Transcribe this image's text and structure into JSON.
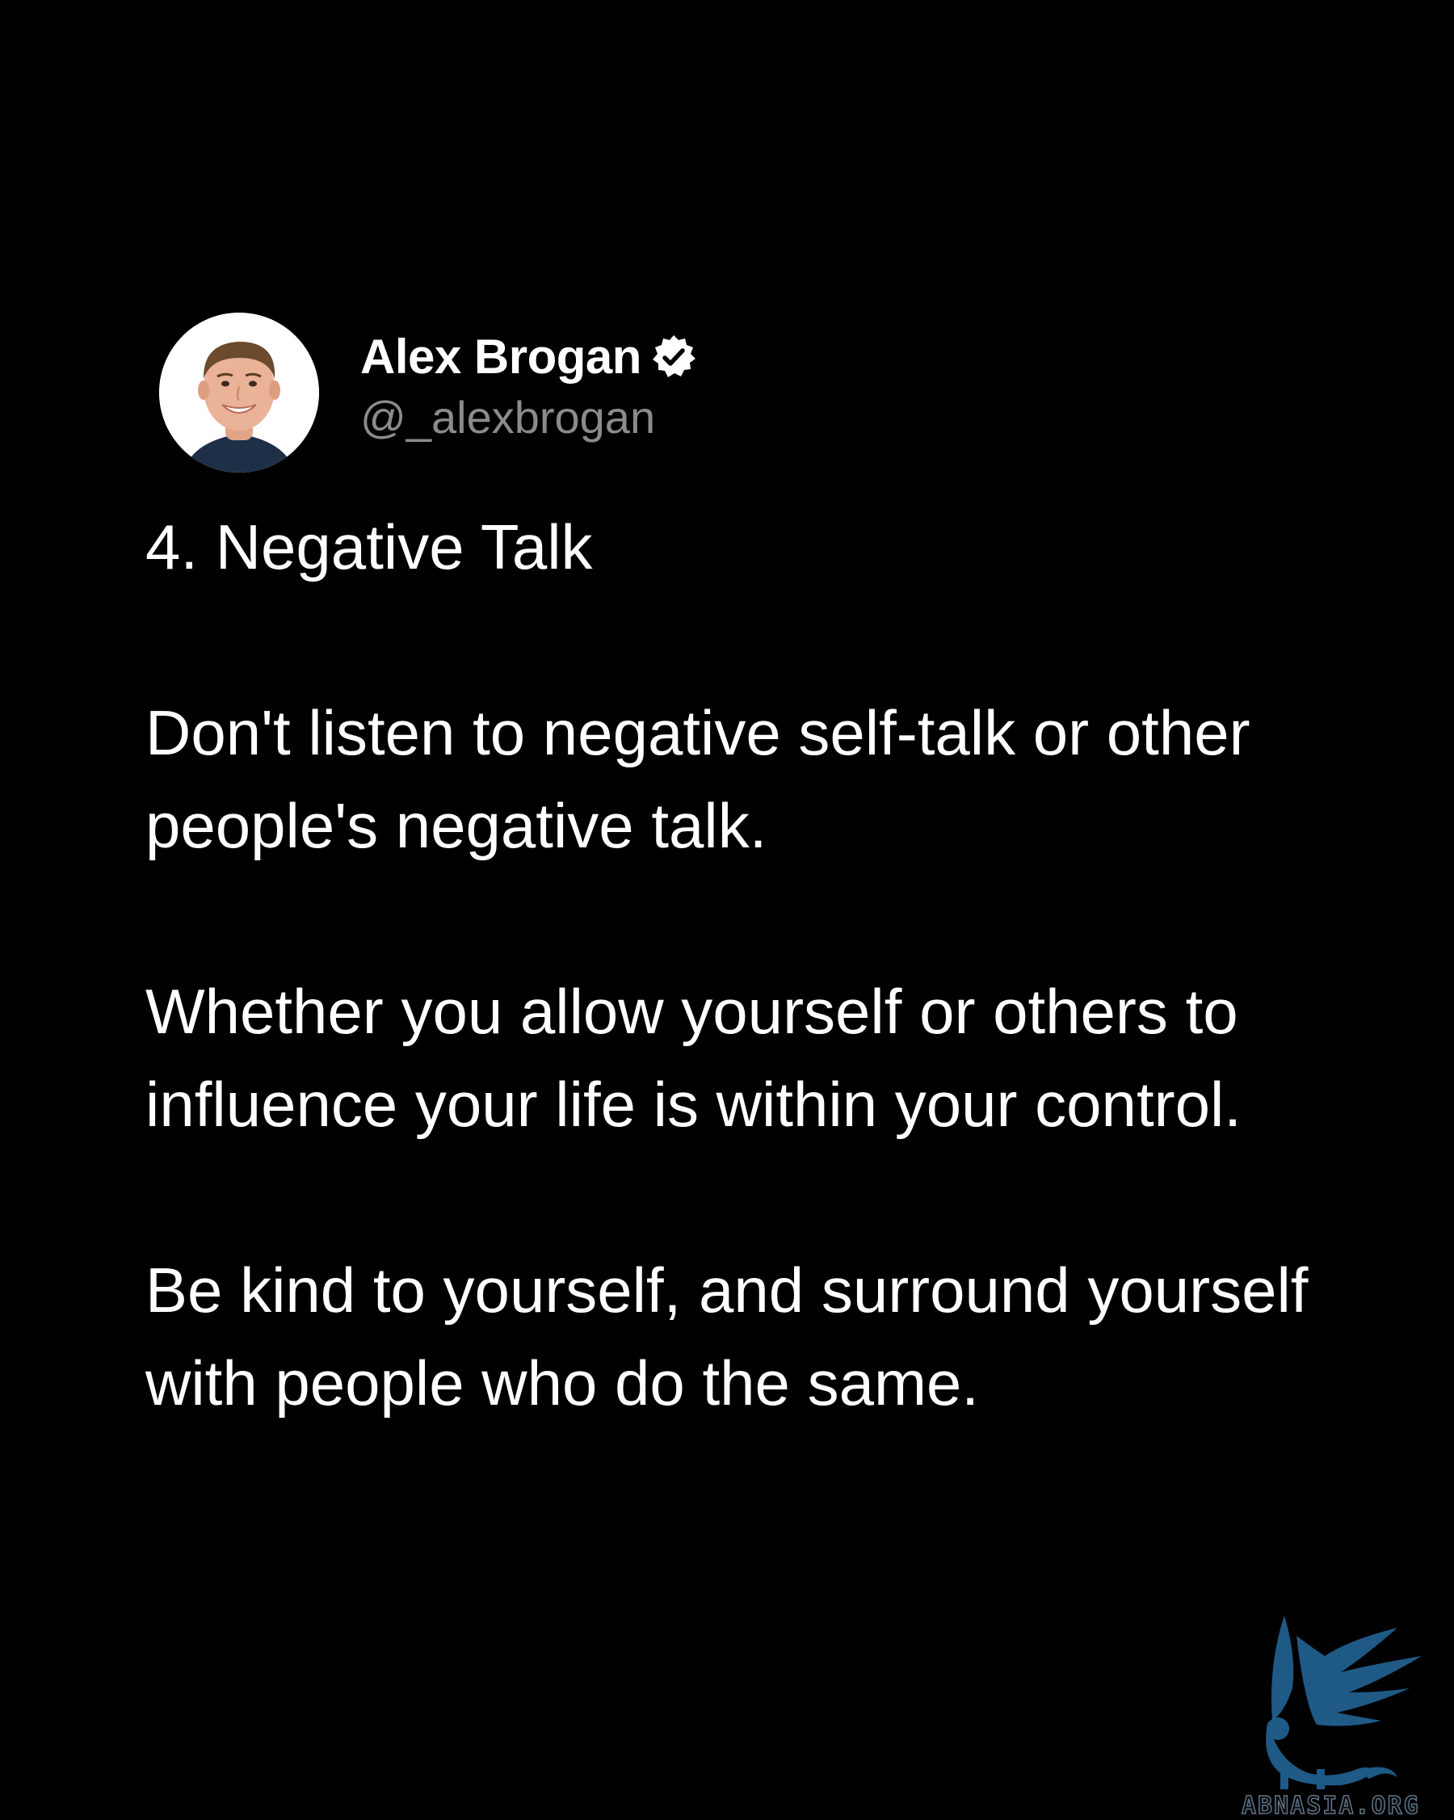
{
  "author": {
    "display_name": "Alex Brogan",
    "handle": "@_alexbrogan",
    "verified_icon": "verified-badge-icon",
    "avatar_icon": "profile-avatar"
  },
  "post": {
    "heading": "4. Negative Talk",
    "paragraphs": [
      "Don't listen to negative self-talk or other people's negative talk.",
      "Whether you allow yourself or others to influence your life is within your control.",
      "Be kind to yourself, and surround yourself with people who do the same."
    ]
  },
  "watermark": {
    "text": "ABNASIA.ORG",
    "logo_icon": "winged-lion-logo",
    "color": "#1f5a86"
  },
  "colors": {
    "background": "#000000",
    "text": "#ffffff",
    "handle": "#8b8b8b"
  }
}
